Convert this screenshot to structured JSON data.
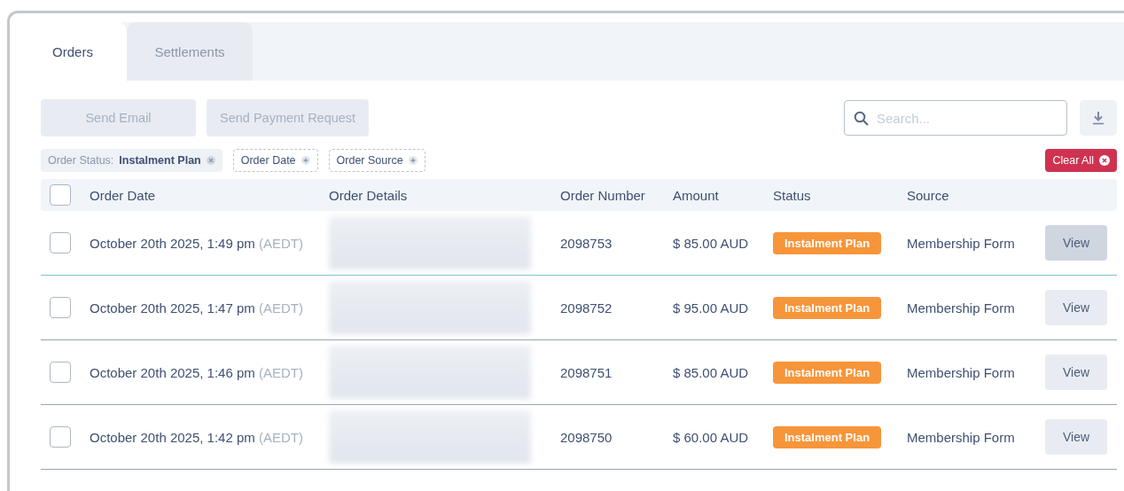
{
  "tabs": [
    {
      "label": "Orders",
      "selected": true
    },
    {
      "label": "Settlements",
      "selected": false
    }
  ],
  "toolbar": {
    "buttons": [
      {
        "label": "Send Email",
        "disabled": true
      },
      {
        "label": "Send Payment Request",
        "disabled": true
      }
    ],
    "search": {
      "placeholder": "Search..."
    }
  },
  "filters": [
    {
      "label": "Order Status:",
      "value": "Instalment Plan",
      "active": true
    },
    {
      "label": "Order Date",
      "active": false
    },
    {
      "label": "Order Source",
      "active": false
    }
  ],
  "clear_all": "Clear All",
  "table": {
    "select_all_checked": false,
    "columns": [
      "Order Date",
      "Order Details",
      "Order Number",
      "Amount",
      "Status",
      "Source"
    ],
    "rows": [
      {
        "date": "October 20th 2025, 1:49 pm",
        "tz": "(AEDT)",
        "order_number": "2098753",
        "amount": "$ 85.00 AUD",
        "status": "Instalment Plan",
        "source": "Membership Form",
        "action": "View",
        "checked": false,
        "hovered": true
      },
      {
        "date": "October 20th 2025, 1:47 pm",
        "tz": "(AEDT)",
        "order_number": "2098752",
        "amount": "$ 95.00 AUD",
        "status": "Instalment Plan",
        "source": "Membership Form",
        "action": "View",
        "checked": false,
        "hovered": false
      },
      {
        "date": "October 20th 2025, 1:46 pm",
        "tz": "(AEDT)",
        "order_number": "2098751",
        "amount": "$ 85.00 AUD",
        "status": "Instalment Plan",
        "source": "Membership Form",
        "action": "View",
        "checked": false,
        "hovered": false
      },
      {
        "date": "October 20th 2025, 1:42 pm",
        "tz": "(AEDT)",
        "order_number": "2098750",
        "amount": "$ 60.00 AUD",
        "status": "Instalment Plan",
        "source": "Membership Form",
        "action": "View",
        "checked": false,
        "hovered": false
      }
    ]
  }
}
